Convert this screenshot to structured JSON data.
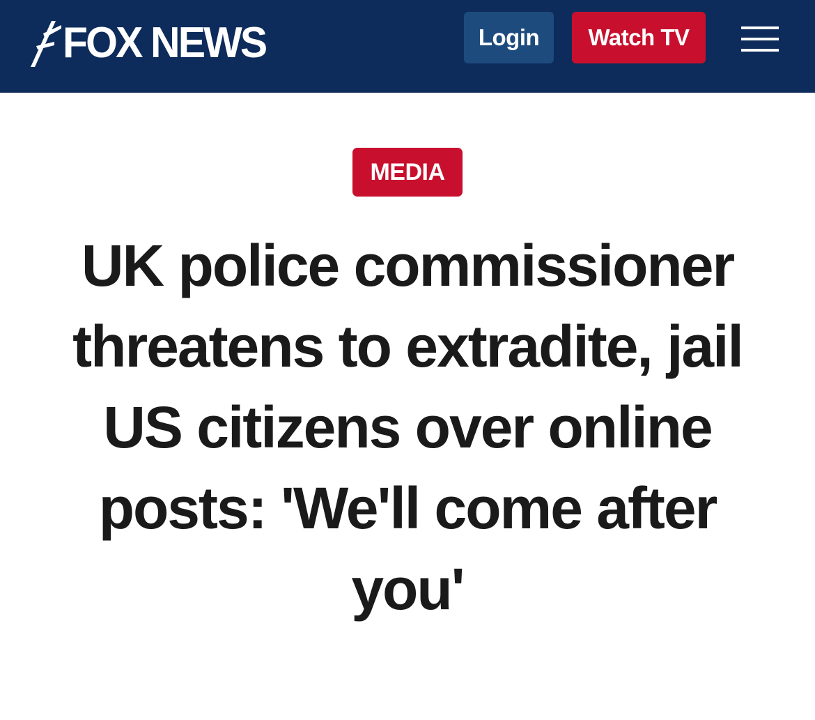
{
  "header": {
    "logo": {
      "text": "FOX NEWS",
      "icon": "fox-news-spotlight-icon"
    },
    "login_label": "Login",
    "watch_tv_label": "Watch TV",
    "menu_icon": "hamburger-menu-icon"
  },
  "article": {
    "category": "MEDIA",
    "headline": "UK police commissioner threatens to extradite, jail US citizens over online posts: 'We'll come after you'"
  },
  "colors": {
    "header_bg": "#0d2c5b",
    "login_bg": "#1d4b7e",
    "accent_red": "#c8102e",
    "headline_text": "#1a1a1a"
  }
}
